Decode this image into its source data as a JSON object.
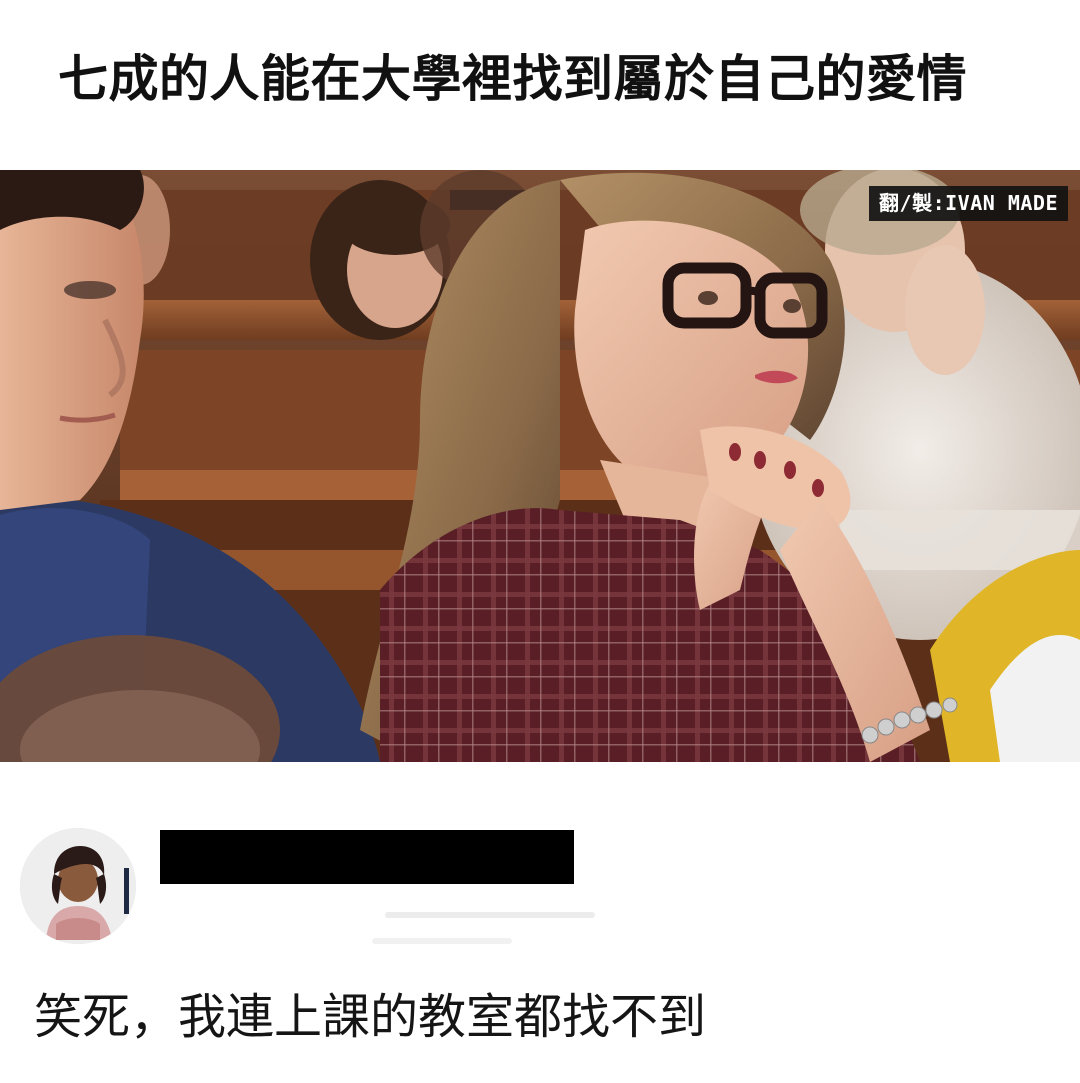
{
  "post": {
    "headline": "七成的人能在大學裡找到屬於自己的愛情",
    "watermark": "翻/製:IVAN MADE",
    "comment_text": "笑死，我連上課的教室都找不到"
  },
  "colors": {
    "background": "#ffffff",
    "text": "#111111",
    "redaction": "#000000",
    "watermark_bg": "#121212"
  },
  "icons": {
    "avatar": "cartoon-character-avatar"
  }
}
